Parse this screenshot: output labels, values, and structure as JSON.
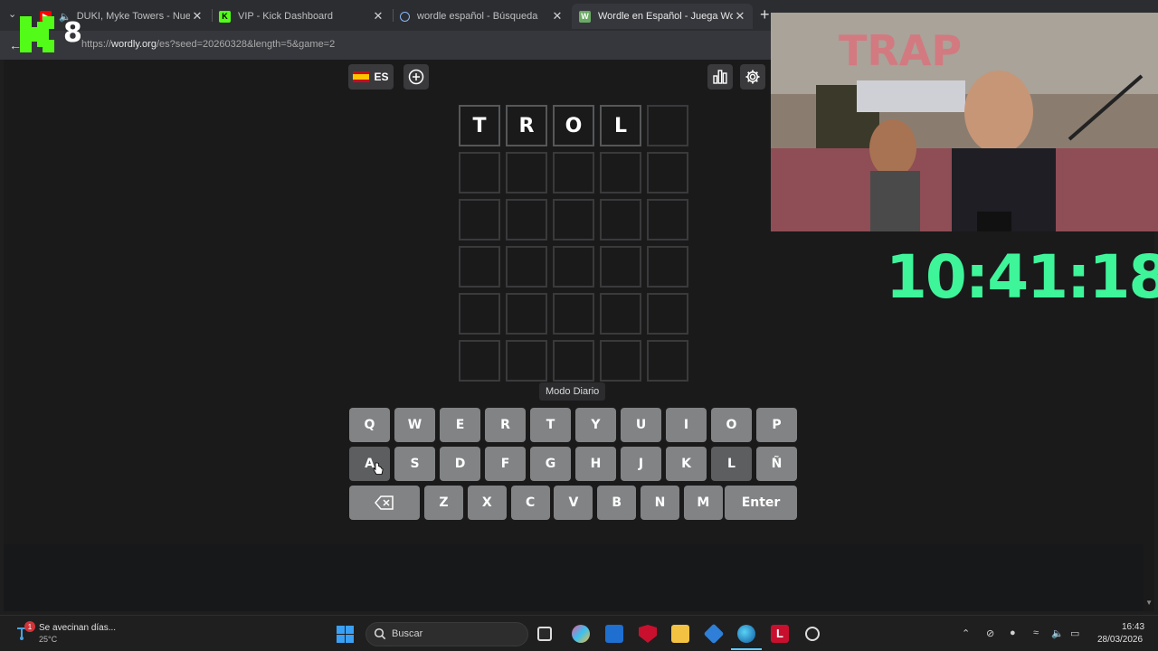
{
  "browser": {
    "tabs": [
      {
        "title": "DUKI, Myke Towers - Nueva E",
        "active": false
      },
      {
        "title": "VIP - Kick Dashboard",
        "active": false
      },
      {
        "title": "wordle español - Búsqueda",
        "active": false
      },
      {
        "title": "Wordle en Español - Juega Wordle",
        "active": true
      }
    ],
    "url_prefix": "https://",
    "url_domain": "wordly.org",
    "url_path": "/es?seed=20260328&length=5&game=2"
  },
  "overlay": {
    "kick_number": "8",
    "timer": "10:41:18"
  },
  "game": {
    "language": "ES",
    "mode_label": "Modo Diario",
    "board": [
      [
        "T",
        "R",
        "O",
        "L",
        ""
      ],
      [
        "",
        "",
        "",
        "",
        ""
      ],
      [
        "",
        "",
        "",
        "",
        ""
      ],
      [
        "",
        "",
        "",
        "",
        ""
      ],
      [
        "",
        "",
        "",
        "",
        ""
      ],
      [
        "",
        "",
        "",
        "",
        ""
      ]
    ],
    "keyboard": {
      "row1": [
        "Q",
        "W",
        "E",
        "R",
        "T",
        "Y",
        "U",
        "I",
        "O",
        "P"
      ],
      "row2": [
        "A",
        "S",
        "D",
        "F",
        "G",
        "H",
        "J",
        "K",
        "L",
        "Ñ"
      ],
      "row3": [
        "Z",
        "X",
        "C",
        "V",
        "B",
        "N",
        "M"
      ],
      "enter_label": "Enter"
    },
    "colors": {
      "key": "#818384",
      "key_used": "#5c5e60",
      "tile_border": "#3a3a3c",
      "background": "#1a1a1b"
    }
  },
  "taskbar": {
    "weather_title": "Se avecinan días...",
    "weather_temp": "25°C",
    "notification_count": "1",
    "search_placeholder": "Buscar",
    "time": "16:43",
    "date": "28/03/2026"
  }
}
